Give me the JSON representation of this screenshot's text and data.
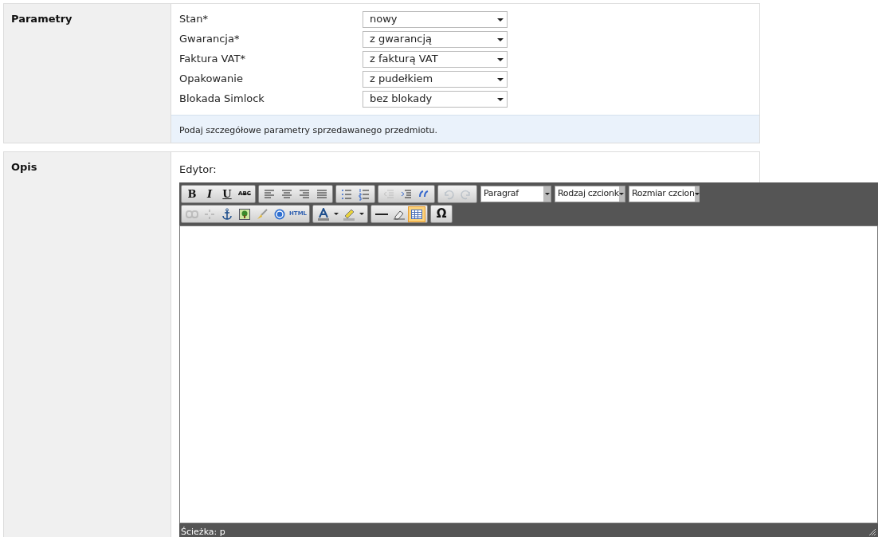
{
  "parameters": {
    "title": "Parametry",
    "fields": [
      {
        "label": "Stan*",
        "value": "nowy"
      },
      {
        "label": "Gwarancja*",
        "value": "z gwarancją"
      },
      {
        "label": "Faktura VAT*",
        "value": "z fakturą VAT"
      },
      {
        "label": "Opakowanie",
        "value": "z pudełkiem"
      },
      {
        "label": "Blokada Simlock",
        "value": "bez blokady"
      }
    ],
    "hint": "Podaj szczegółowe parametry sprzedawanego przedmiotu."
  },
  "description": {
    "title": "Opis",
    "editor_label": "Edytor:",
    "toolbar_rows": [
      {
        "groups": [
          [
            {
              "kind": "bold",
              "label": "B",
              "disabled": false,
              "active": false
            },
            {
              "kind": "italic",
              "label": "I",
              "disabled": false,
              "active": false
            },
            {
              "kind": "underline",
              "label": "U",
              "disabled": false,
              "active": false
            },
            {
              "kind": "strike",
              "label": "ABC",
              "disabled": false,
              "active": false
            }
          ],
          [
            {
              "kind": "align-left",
              "disabled": false,
              "active": false
            },
            {
              "kind": "align-center",
              "disabled": false,
              "active": false
            },
            {
              "kind": "align-right",
              "disabled": false,
              "active": false
            },
            {
              "kind": "align-justify",
              "disabled": false,
              "active": false
            }
          ],
          [
            {
              "kind": "bullet-list",
              "disabled": false,
              "active": false
            },
            {
              "kind": "numbered-list",
              "disabled": false,
              "active": false
            }
          ],
          [
            {
              "kind": "outdent",
              "disabled": true,
              "active": false
            },
            {
              "kind": "indent",
              "disabled": false,
              "active": false
            },
            {
              "kind": "quote",
              "disabled": false,
              "active": false
            }
          ],
          [
            {
              "kind": "undo",
              "disabled": true,
              "active": false
            },
            {
              "kind": "redo",
              "disabled": true,
              "active": false
            }
          ]
        ],
        "selects": [
          "Paragraf",
          "Rodzaj czcionk",
          "Rozmiar czcion"
        ]
      },
      {
        "groups": [
          [
            {
              "kind": "link",
              "disabled": true,
              "active": false
            },
            {
              "kind": "unlink",
              "disabled": true,
              "active": false
            },
            {
              "kind": "anchor",
              "disabled": false,
              "active": false
            },
            {
              "kind": "image",
              "disabled": false,
              "active": false
            },
            {
              "kind": "brush",
              "disabled": false,
              "active": false
            },
            {
              "kind": "help",
              "disabled": false,
              "active": false
            },
            {
              "kind": "html",
              "label": "HTML",
              "disabled": false,
              "active": false
            }
          ],
          [
            {
              "kind": "text-color",
              "disabled": false,
              "active": false
            },
            {
              "kind": "caret",
              "disabled": false,
              "active": false
            },
            {
              "kind": "highlight",
              "disabled": false,
              "active": false
            },
            {
              "kind": "caret",
              "disabled": false,
              "active": false
            }
          ],
          [
            {
              "kind": "rule",
              "disabled": false,
              "active": false
            },
            {
              "kind": "eraser",
              "disabled": false,
              "active": false
            },
            {
              "kind": "table",
              "disabled": false,
              "active": true
            }
          ],
          [
            {
              "kind": "omega",
              "label": "Ω",
              "disabled": false,
              "active": false
            }
          ]
        ],
        "selects": []
      }
    ],
    "status_path": "Ścieżka: p"
  }
}
